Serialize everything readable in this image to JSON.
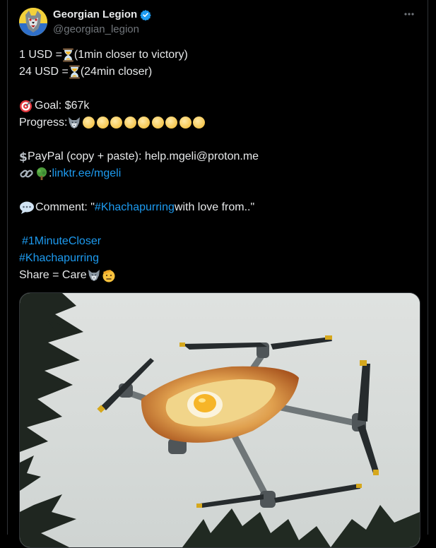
{
  "author": {
    "display_name": "Georgian Legion",
    "handle": "@georgian_legion"
  },
  "icons": {
    "more": "more-horizontal-icon",
    "verified": "verified-badge-icon",
    "hourglass": "hourglass-icon",
    "target": "direct-hit-icon",
    "wolf": "wolf-icon",
    "moon": "full-moon-icon",
    "dollar": "heavy-dollar-sign-icon",
    "link": "link-icon",
    "tree": "tree-icon",
    "speech": "speech-bubble-icon",
    "salute": "saluting-face-icon"
  },
  "colors": {
    "background": "#000000",
    "text": "#e7e9ea",
    "muted": "#71767b",
    "link": "#1d9bf0",
    "verified": "#1d9bf0"
  },
  "tweet": {
    "line1_pre": "1 USD = ",
    "line1_post": " (1min closer to victory)",
    "line2_pre": "24 USD = ",
    "line2_post": " (24min closer)",
    "goal": "Goal: $67k",
    "progress_label": "Progress: ",
    "progress_filled": 1,
    "progress_total": 10,
    "paypal": " PayPal (copy + paste): help.mgeli@proton.me",
    "link_sep": ":",
    "link_text": "linktr.ee/mgeli",
    "comment_pre": "Comment: \"",
    "comment_hashtag": "#Khachapurring",
    "comment_post": " with love from..\"",
    "hashtag1": "#1MinuteCloser",
    "hashtag2": "#Khachapurring",
    "share": " Share = Care"
  }
}
